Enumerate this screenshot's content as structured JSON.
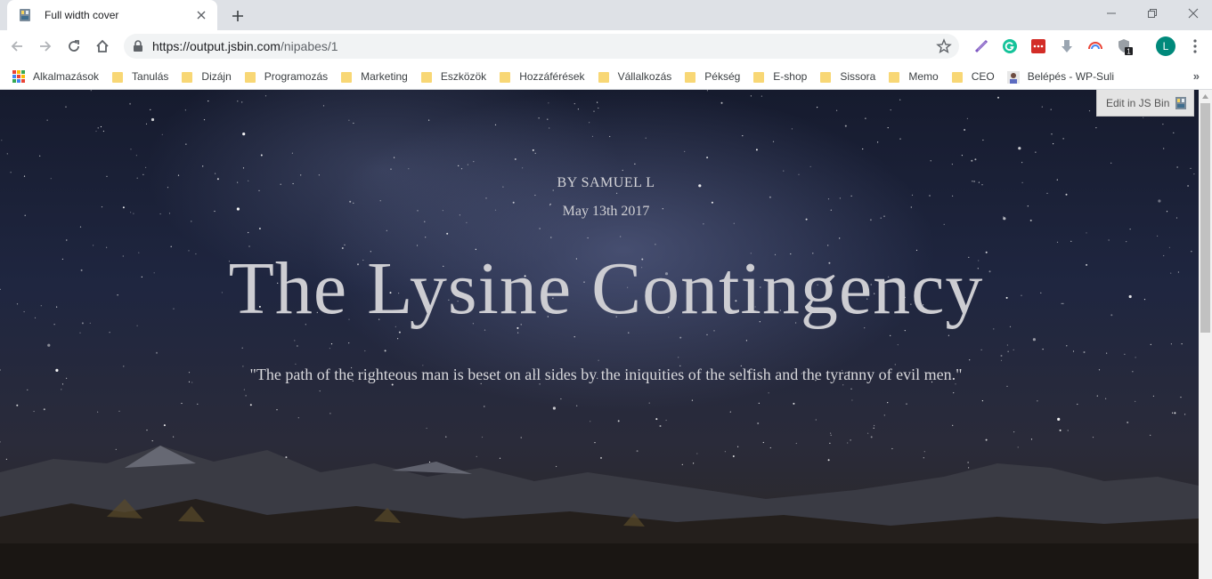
{
  "browser": {
    "tab": {
      "title": "Full width cover",
      "favicon": "jsbin-icon"
    },
    "new_tab_icon": "plus-icon",
    "window_controls": [
      "minimize-icon",
      "restore-icon",
      "close-icon"
    ],
    "url": {
      "host": "https://output.jsbin.com",
      "path": "/nipabes/1"
    },
    "profile_initial": "L",
    "extension_badge": "1",
    "bookmarks": [
      {
        "label": "Alkalmazások",
        "icon": "apps-icon"
      },
      {
        "label": "Tanulás",
        "icon": "folder-icon"
      },
      {
        "label": "Dizájn",
        "icon": "folder-icon"
      },
      {
        "label": "Programozás",
        "icon": "folder-icon"
      },
      {
        "label": "Marketing",
        "icon": "folder-icon"
      },
      {
        "label": "Eszközök",
        "icon": "folder-icon"
      },
      {
        "label": "Hozzáférések",
        "icon": "folder-icon"
      },
      {
        "label": "Vállalkozás",
        "icon": "folder-icon"
      },
      {
        "label": "Pékség",
        "icon": "folder-icon"
      },
      {
        "label": "E-shop",
        "icon": "folder-icon"
      },
      {
        "label": "Sissora",
        "icon": "folder-icon"
      },
      {
        "label": "Memo",
        "icon": "folder-icon"
      },
      {
        "label": "CEO",
        "icon": "folder-icon"
      },
      {
        "label": "Belépés - WP-Suli",
        "icon": "site-avatar-icon"
      }
    ],
    "bookmarks_more": "»"
  },
  "page": {
    "edit_button": "Edit in JS Bin",
    "byline": "BY SAMUEL L",
    "date": "May 13th 2017",
    "title": "The Lysine Contingency",
    "quote": "\"The path of the righteous man is beset on all sides by the iniquities of the selfish and the tyranny of evil men.\""
  },
  "colors": {
    "tabstrip": "#dee1e6",
    "omnibox": "#f1f3f4",
    "folder": "#f8d775",
    "text_on_cover": "#cdcdd2",
    "avatar": "#00897b"
  }
}
